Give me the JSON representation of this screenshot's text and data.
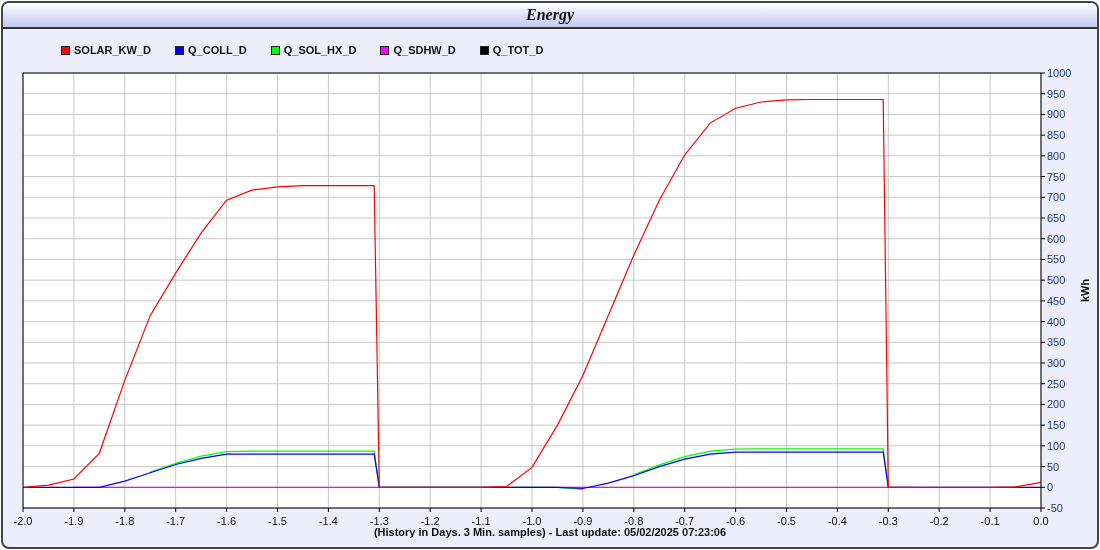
{
  "window": {
    "title": "Energy"
  },
  "chart": {
    "chart_data": {
      "type": "line",
      "xlabel": "(History in Days. 3 Min. samples) - Last update: 05/02/2025 07:23:06",
      "ylabel": "kWh",
      "x": [
        -2.0,
        -1.95,
        -1.9,
        -1.85,
        -1.8,
        -1.75,
        -1.7,
        -1.65,
        -1.6,
        -1.55,
        -1.5,
        -1.45,
        -1.4,
        -1.35,
        -1.31,
        -1.3,
        -1.25,
        -1.2,
        -1.15,
        -1.1,
        -1.05,
        -1.0,
        -0.95,
        -0.9,
        -0.85,
        -0.8,
        -0.75,
        -0.7,
        -0.65,
        -0.6,
        -0.55,
        -0.5,
        -0.45,
        -0.4,
        -0.35,
        -0.31,
        -0.3,
        -0.25,
        -0.2,
        -0.15,
        -0.1,
        -0.05,
        0.0
      ],
      "series": [
        {
          "name": "SOLAR_KW_D",
          "color": "#ff0000",
          "values": [
            0,
            5,
            20,
            82,
            258,
            415,
            517,
            614,
            693,
            717,
            725,
            728,
            728,
            728,
            728,
            0,
            0,
            0,
            0,
            0,
            2,
            48,
            150,
            270,
            415,
            560,
            693,
            802,
            879,
            915,
            930,
            935,
            936,
            936,
            936,
            936,
            0,
            0,
            0,
            0,
            0,
            1,
            12
          ]
        },
        {
          "name": "Q_COLL_D",
          "color": "#0000ff",
          "values": [
            0,
            0,
            0,
            0,
            15,
            35,
            55,
            70,
            80,
            80,
            80,
            80,
            80,
            80,
            80,
            0,
            0,
            0,
            0,
            0,
            0,
            0,
            0,
            -3,
            10,
            28,
            50,
            68,
            80,
            85,
            85,
            85,
            85,
            85,
            85,
            85,
            0,
            0,
            0,
            0,
            0,
            0,
            0
          ]
        },
        {
          "name": "Q_SOL_HX_D",
          "color": "#00ff00",
          "values": [
            null,
            null,
            null,
            null,
            null,
            37,
            58,
            75,
            86,
            87,
            87,
            87,
            87,
            87,
            87,
            0,
            0,
            0,
            0,
            0,
            0,
            0,
            0,
            -5,
            null,
            30,
            54,
            74,
            87,
            92,
            93,
            93,
            93,
            93,
            93,
            93,
            0,
            null,
            null,
            null,
            null,
            null,
            null
          ]
        },
        {
          "name": "Q_SDHW_D",
          "color": "#ff00ff",
          "values": [
            null,
            null,
            0,
            0,
            0,
            0,
            0,
            0,
            0,
            0,
            0,
            0,
            0,
            0,
            0,
            0,
            0,
            0,
            0,
            0,
            0,
            0,
            0,
            0,
            0,
            0,
            0,
            0,
            0,
            0,
            0,
            0,
            0,
            0,
            0,
            0,
            0,
            0,
            null,
            null,
            null,
            null,
            null
          ]
        },
        {
          "name": "Q_TOT_D",
          "color": "#000000",
          "values": [
            null,
            null,
            null,
            null,
            null,
            null,
            null,
            null,
            null,
            null,
            null,
            null,
            null,
            null,
            null,
            null,
            null,
            null,
            null,
            null,
            null,
            null,
            null,
            null,
            null,
            null,
            null,
            null,
            null,
            null,
            null,
            null,
            null,
            null,
            null,
            null,
            null,
            null,
            null,
            null,
            null,
            null,
            null
          ]
        }
      ],
      "grid": true,
      "xlim": [
        -2,
        0
      ],
      "ylim": [
        -50,
        1000
      ],
      "xticks": [
        {
          "value": -2,
          "label": "-2.0"
        },
        {
          "value": -1.9,
          "label": "-1.9"
        },
        {
          "value": -1.8,
          "label": "-1.8"
        },
        {
          "value": -1.7,
          "label": "-1.7"
        },
        {
          "value": -1.6,
          "label": "-1.6"
        },
        {
          "value": -1.5,
          "label": "-1.5"
        },
        {
          "value": -1.4,
          "label": "-1.4"
        },
        {
          "value": -1.3,
          "label": "-1.3"
        },
        {
          "value": -1.2,
          "label": "-1.2"
        },
        {
          "value": -1.1,
          "label": "-1.1"
        },
        {
          "value": -1,
          "label": "-1.0"
        },
        {
          "value": -0.9,
          "label": "-0.9"
        },
        {
          "value": -0.8,
          "label": "-0.8"
        },
        {
          "value": -0.7,
          "label": "-0.7"
        },
        {
          "value": -0.6,
          "label": "-0.6"
        },
        {
          "value": -0.5,
          "label": "-0.5"
        },
        {
          "value": -0.4,
          "label": "-0.4"
        },
        {
          "value": -0.3,
          "label": "-0.3"
        },
        {
          "value": -0.2,
          "label": "-0.2"
        },
        {
          "value": -0.1,
          "label": "-0.1"
        },
        {
          "value": 0,
          "label": "0.0"
        }
      ],
      "yticks": [
        -50,
        0,
        50,
        100,
        150,
        200,
        250,
        300,
        350,
        400,
        450,
        500,
        550,
        600,
        650,
        700,
        750,
        800,
        850,
        900,
        950,
        1000
      ]
    }
  }
}
